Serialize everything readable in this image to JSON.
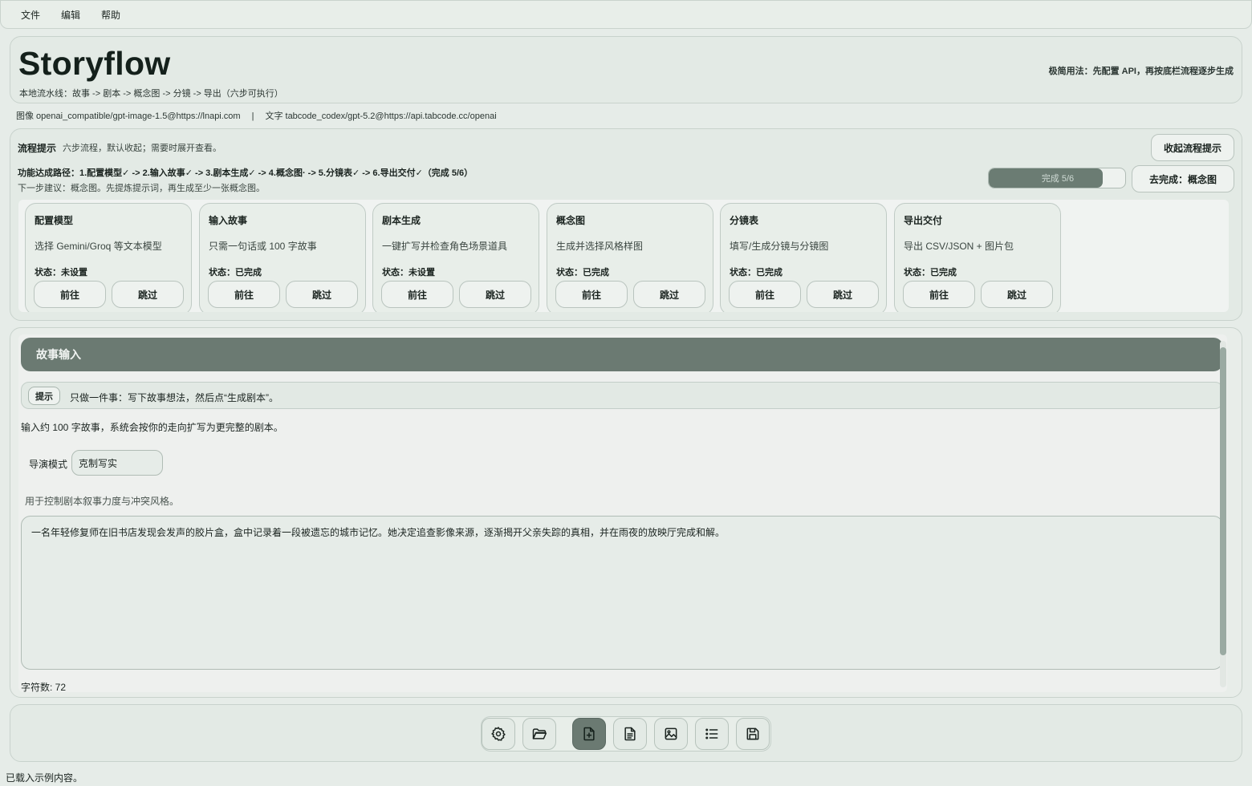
{
  "menu": [
    "文件",
    "编辑",
    "帮助"
  ],
  "header": {
    "title": "Storyflow",
    "subtitle": "本地流水线：故事 -> 剧本 -> 概念图 -> 分镜 -> 导出（六步可执行）",
    "quick_tip": "极简用法：先配置 API，再按底栏流程逐步生成"
  },
  "models": {
    "image": "图像 openai_compatible/gpt-image-1.5@https://lnapi.com",
    "separator": "|",
    "text": "文字 tabcode_codex/gpt-5.2@https://api.tabcode.cc/openai"
  },
  "flow": {
    "title": "流程提示",
    "description": "六步流程，默认收起；需要时展开查看。",
    "collapse_label": "收起流程提示",
    "path": "功能达成路径：1.配置模型✓ -> 2.输入故事✓ -> 3.剧本生成✓ -> 4.概念图· -> 5.分镜表✓ -> 6.导出交付✓（完成 5/6）",
    "next_hint": "下一步建议：概念图。先提炼提示词，再生成至少一张概念图。",
    "progress_label": "完成 5/6",
    "progress_value": 0.8333,
    "goto_label": "去完成：概念图",
    "steps": [
      {
        "title": "配置模型",
        "desc": "选择 Gemini/Groq 等文本模型",
        "status": "状态：未设置",
        "go": "前往",
        "skip": "跳过"
      },
      {
        "title": "输入故事",
        "desc": "只需一句话或 100 字故事",
        "status": "状态：已完成",
        "go": "前往",
        "skip": "跳过"
      },
      {
        "title": "剧本生成",
        "desc": "一键扩写并检查角色场景道具",
        "status": "状态：未设置",
        "go": "前往",
        "skip": "跳过"
      },
      {
        "title": "概念图",
        "desc": "生成并选择风格样图",
        "status": "状态：已完成",
        "go": "前往",
        "skip": "跳过"
      },
      {
        "title": "分镜表",
        "desc": "填写/生成分镜与分镜图",
        "status": "状态：已完成",
        "go": "前往",
        "skip": "跳过"
      },
      {
        "title": "导出交付",
        "desc": "导出 CSV/JSON + 图片包",
        "status": "状态：已完成",
        "go": "前往",
        "skip": "跳过"
      }
    ]
  },
  "story": {
    "section_title": "故事输入",
    "hint_chip": "提示",
    "hint_text": "只做一件事：写下故事想法，然后点“生成剧本”。",
    "intro": "输入约 100 字故事，系统会按你的走向扩写为更完整的剧本。",
    "mode_label": "导演模式",
    "mode_value": "克制写实",
    "mode_help": "用于控制剧本叙事力度与冲突风格。",
    "text": "一名年轻修复师在旧书店发现会发声的胶片盒，盒中记录着一段被遗忘的城市记忆。她决定追查影像来源，逐渐揭开父亲失踪的真相，并在雨夜的放映厅完成和解。",
    "char_count": "字符数: 72"
  },
  "toolbar": {
    "buttons": [
      "gear-icon",
      "folder-open-icon",
      "new-file-icon",
      "document-icon",
      "image-icon",
      "list-icon",
      "save-icon"
    ],
    "active_index": 2
  },
  "status_bar": "已载入示例内容。"
}
